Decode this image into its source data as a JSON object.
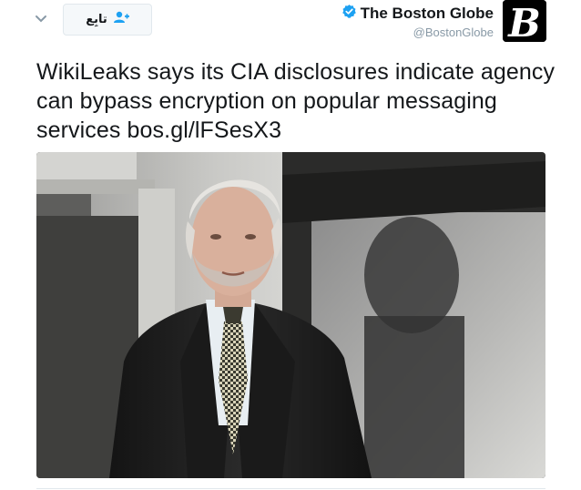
{
  "tweet": {
    "author": {
      "display_name": "The Boston Globe",
      "handle": "@BostonGlobe",
      "verified_icon": "verified-badge-icon",
      "avatar_letter": "B"
    },
    "follow_button": {
      "label": "تابِع",
      "icon": "add-user-icon"
    },
    "menu_icon": "chevron-down-icon",
    "text": "WikiLeaks says its CIA disclosures indicate agency can bypass encryption on popular messaging services",
    "link": "bos.gl/lFSesX3",
    "media": {
      "type": "photo"
    }
  },
  "colors": {
    "verified": "#1da1f2",
    "follow_icon": "#1da1f2",
    "text": "#14171a",
    "muted": "#8899a6"
  }
}
